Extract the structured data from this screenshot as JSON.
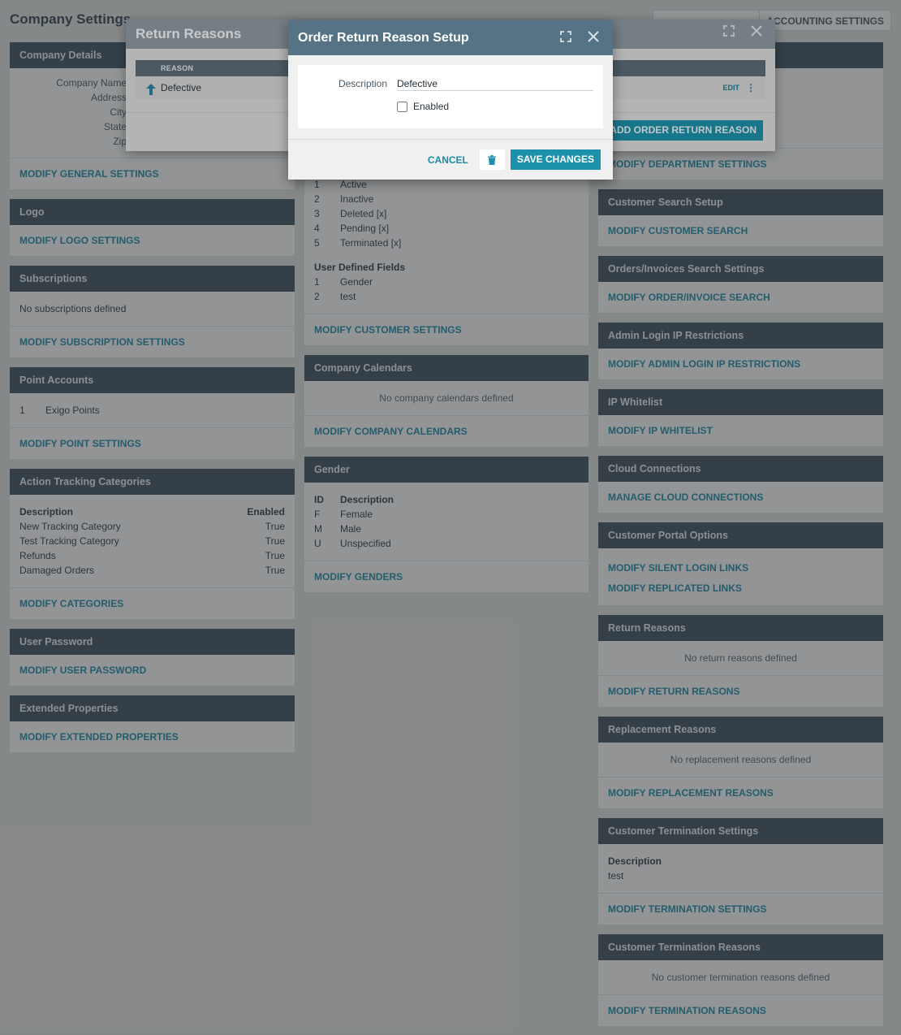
{
  "page": {
    "title": "Company Settings",
    "top_tabs": [
      "",
      "ACCOUNTING SETTINGS"
    ]
  },
  "company_details": {
    "header": "Company Details",
    "fields": [
      {
        "label": "Company Name",
        "value": ""
      },
      {
        "label": "Address",
        "value": ""
      },
      {
        "label": "City",
        "value": ""
      },
      {
        "label": "State",
        "value": ""
      },
      {
        "label": "Zip",
        "value": ""
      }
    ],
    "link": "MODIFY GENERAL SETTINGS"
  },
  "logo": {
    "header": "Logo",
    "link": "MODIFY LOGO SETTINGS"
  },
  "subscriptions": {
    "header": "Subscriptions",
    "empty": "No subscriptions defined",
    "link": "MODIFY SUBSCRIPTION SETTINGS"
  },
  "point_accounts": {
    "header": "Point Accounts",
    "rows": [
      {
        "n": "1",
        "name": "Exigo Points"
      }
    ],
    "link": "MODIFY POINT SETTINGS"
  },
  "action_tracking": {
    "header": "Action Tracking Categories",
    "col_description": "Description",
    "col_enabled": "Enabled",
    "rows": [
      {
        "description": "New Tracking Category",
        "enabled": "True"
      },
      {
        "description": "Test Tracking Category",
        "enabled": "True"
      },
      {
        "description": "Refunds",
        "enabled": "True"
      },
      {
        "description": "Damaged Orders",
        "enabled": "True"
      }
    ],
    "link": "MODIFY CATEGORIES"
  },
  "user_password": {
    "header": "User Password",
    "link": "MODIFY USER PASSWORD"
  },
  "extended_properties": {
    "header": "Extended Properties",
    "link": "MODIFY EXTENDED PROPERTIES"
  },
  "customer_settings": {
    "statuses": [
      {
        "n": "1",
        "name": "Active"
      },
      {
        "n": "2",
        "name": "Inactive"
      },
      {
        "n": "3",
        "name": "Deleted [x]"
      },
      {
        "n": "4",
        "name": "Pending [x]"
      },
      {
        "n": "5",
        "name": "Terminated [x]"
      }
    ],
    "udf_title": "User Defined Fields",
    "udf": [
      {
        "n": "1",
        "name": "Gender"
      },
      {
        "n": "2",
        "name": "test"
      }
    ],
    "link": "MODIFY CUSTOMER SETTINGS"
  },
  "company_calendars": {
    "header": "Company Calendars",
    "empty": "No company calendars defined",
    "link": "MODIFY COMPANY CALENDARS"
  },
  "gender": {
    "header": "Gender",
    "col_id": "ID",
    "col_description": "Description",
    "rows": [
      {
        "id": "F",
        "description": "Female"
      },
      {
        "id": "M",
        "description": "Male"
      },
      {
        "id": "U",
        "description": "Unspecified"
      }
    ],
    "link": "MODIFY GENDERS"
  },
  "department": {
    "link": "MODIFY DEPARTMENT SETTINGS"
  },
  "customer_search": {
    "header": "Customer Search Setup",
    "link": "MODIFY CUSTOMER SEARCH"
  },
  "orders_search": {
    "header": "Orders/Invoices Search Settings",
    "link": "MODIFY ORDER/INVOICE SEARCH"
  },
  "admin_ip": {
    "header": "Admin Login IP Restrictions",
    "link": "MODIFY ADMIN LOGIN IP RESTRICTIONS"
  },
  "ip_whitelist": {
    "header": "IP Whitelist",
    "link": "MODIFY IP WHITELIST"
  },
  "cloud": {
    "header": "Cloud Connections",
    "link": "MANAGE CLOUD CONNECTIONS"
  },
  "portal": {
    "header": "Customer Portal Options",
    "link1": "MODIFY SILENT LOGIN LINKS",
    "link2": "MODIFY REPLICATED LINKS"
  },
  "return_reasons_card": {
    "header": "Return Reasons",
    "empty": "No return reasons defined",
    "link": "MODIFY RETURN REASONS"
  },
  "replacement_reasons": {
    "header": "Replacement Reasons",
    "empty": "No replacement reasons defined",
    "link": "MODIFY REPLACEMENT REASONS"
  },
  "termination_settings": {
    "header": "Customer Termination Settings",
    "col_description": "Description",
    "value": "test",
    "link": "MODIFY TERMINATION SETTINGS"
  },
  "termination_reasons": {
    "header": "Customer Termination Reasons",
    "empty": "No customer termination reasons defined",
    "link": "MODIFY TERMINATION REASONS"
  },
  "return_reasons_dialog": {
    "title": "Return Reasons",
    "col_reason": "REASON",
    "row_reason": "Defective",
    "row_edit": "EDIT",
    "row_menu": "⋮",
    "add_button": "ADD ORDER RETURN REASON"
  },
  "modal": {
    "title": "Order Return Reason Setup",
    "description_label": "Description",
    "description_value": "Defective",
    "enabled_label": "Enabled",
    "enabled_checked": false,
    "cancel": "CANCEL",
    "save": "SAVE CHANGES"
  },
  "colors": {
    "header_bg": "#3b4e5c",
    "link": "#1a8ca8",
    "accent_button": "#1d91a9",
    "modal_title_bg": "#557384"
  }
}
